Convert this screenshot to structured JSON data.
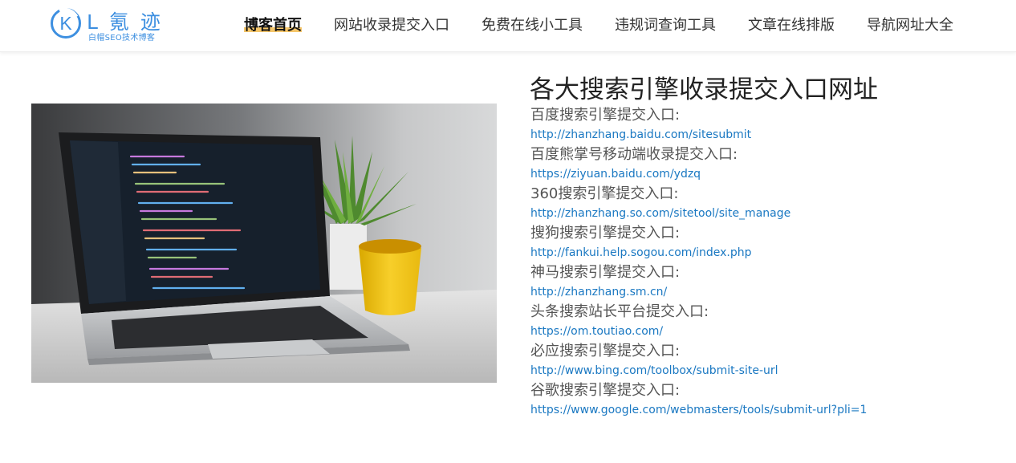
{
  "logo": {
    "letter": "K",
    "title": "L 氪 迹",
    "subtitle": "白帽SEO技术博客",
    "color": "#3d8fe0"
  },
  "nav": {
    "items": [
      {
        "label": "博客首页",
        "active": true
      },
      {
        "label": "网站收录提交入口",
        "active": false
      },
      {
        "label": "免费在线小工具",
        "active": false
      },
      {
        "label": "违规词查询工具",
        "active": false
      },
      {
        "label": "文章在线排版",
        "active": false
      },
      {
        "label": "导航网址大全",
        "active": false
      }
    ],
    "highlight_color": "#f5c66a"
  },
  "photo": {
    "alt": "laptop with code editor and yellow cup"
  },
  "article": {
    "title": "各大搜索引擎收录提交入口网址",
    "entries": [
      {
        "label": "百度搜索引擎提交入口:",
        "url": "http://zhanzhang.baidu.com/sitesubmit"
      },
      {
        "label": "百度熊掌号移动端收录提交入口:",
        "url": "https://ziyuan.baidu.com/ydzq"
      },
      {
        "label": "360搜索引擎提交入口:",
        "url": "http://zhanzhang.so.com/sitetool/site_manage"
      },
      {
        "label": "搜狗搜索引擎提交入口:",
        "url": "http://fankui.help.sogou.com/index.php"
      },
      {
        "label": "神马搜索引擎提交入口:",
        "url": "http://zhanzhang.sm.cn/"
      },
      {
        "label": "头条搜索站长平台提交入口:",
        "url": "https://om.toutiao.com/"
      },
      {
        "label": "必应搜索引擎提交入口:",
        "url": "http://www.bing.com/toolbox/submit-site-url"
      },
      {
        "label": "谷歌搜索引擎提交入口:",
        "url": "https://www.google.com/webmasters/tools/submit-url?pli=1"
      }
    ],
    "link_color": "#1a78c2"
  }
}
